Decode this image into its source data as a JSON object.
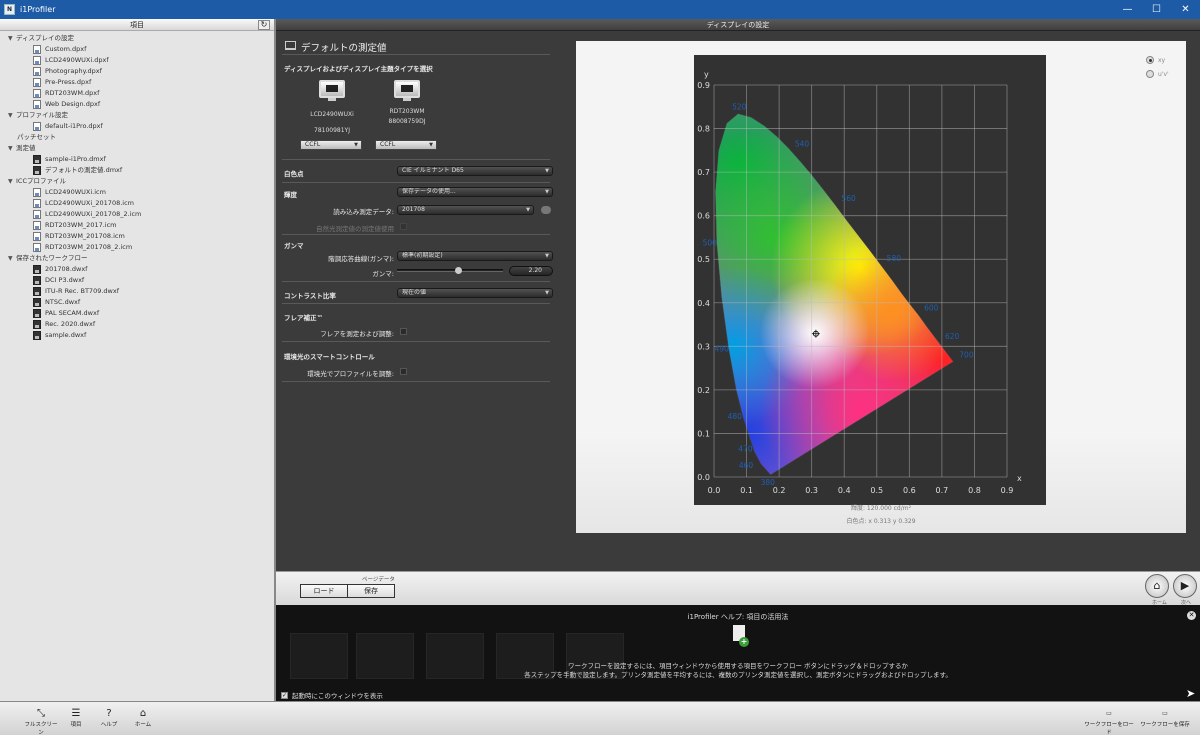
{
  "window": {
    "title": "i1Profiler",
    "app_icon": "N",
    "minimize": "—",
    "maximize": "☐",
    "close": "✕"
  },
  "left_panel": {
    "header": "項目",
    "refresh_icon": "↻",
    "tree": [
      {
        "type": "cat",
        "label": "ディスプレイの設定"
      },
      {
        "type": "leaf",
        "label": "Custom.dpxf",
        "icon": "file"
      },
      {
        "type": "leaf",
        "label": "LCD2490WUXi.dpxf",
        "icon": "file"
      },
      {
        "type": "leaf",
        "label": "Photography.dpxf",
        "icon": "file"
      },
      {
        "type": "leaf",
        "label": "Pre-Press.dpxf",
        "icon": "file"
      },
      {
        "type": "leaf",
        "label": "RDT203WM.dpxf",
        "icon": "file"
      },
      {
        "type": "leaf",
        "label": "Web Design.dpxf",
        "icon": "file"
      },
      {
        "type": "cat",
        "label": "プロファイル設定"
      },
      {
        "type": "leaf",
        "label": "default-i1Pro.dpxf",
        "icon": "file"
      },
      {
        "type": "plain",
        "label": "パッチセット"
      },
      {
        "type": "cat",
        "label": "測定値"
      },
      {
        "type": "leaf",
        "label": "sample-i1Pro.dmxf",
        "icon": "dark"
      },
      {
        "type": "leaf",
        "label": "デフォルトの測定値.dmxf",
        "icon": "dark"
      },
      {
        "type": "cat",
        "label": "ICCプロファイル"
      },
      {
        "type": "leaf",
        "label": "LCD2490WUXi.icm",
        "icon": "file"
      },
      {
        "type": "leaf",
        "label": "LCD2490WUXi_201708.icm",
        "icon": "file"
      },
      {
        "type": "leaf",
        "label": "LCD2490WUXi_201708_2.icm",
        "icon": "file"
      },
      {
        "type": "leaf",
        "label": "RDT203WM_2017.icm",
        "icon": "file"
      },
      {
        "type": "leaf",
        "label": "RDT203WM_201708.icm",
        "icon": "file"
      },
      {
        "type": "leaf",
        "label": "RDT203WM_201708_2.icm",
        "icon": "file"
      },
      {
        "type": "cat",
        "label": "保存されたワークフロー"
      },
      {
        "type": "leaf",
        "label": "201708.dwxf",
        "icon": "dark"
      },
      {
        "type": "leaf",
        "label": "DCI P3.dwxf",
        "icon": "dark"
      },
      {
        "type": "leaf",
        "label": "ITU-R Rec. BT709.dwxf",
        "icon": "dark"
      },
      {
        "type": "leaf",
        "label": "NTSC.dwxf",
        "icon": "dark"
      },
      {
        "type": "leaf",
        "label": "PAL SECAM.dwxf",
        "icon": "dark"
      },
      {
        "type": "leaf",
        "label": "Rec. 2020.dwxf",
        "icon": "dark"
      },
      {
        "type": "leaf",
        "label": "sample.dwxf",
        "icon": "dark"
      }
    ]
  },
  "section_header": "ディスプレイの設定",
  "settings": {
    "title": "デフォルトの測定値",
    "display_select_label": "ディスプレイおよびディスプレイ主題タイプを選択",
    "monitor1_name": "LCD2490WUXi",
    "monitor1_serial": "78100981YJ",
    "monitor2_name": "RDT203WM",
    "monitor2_serial": "88008759DJ",
    "monitor1_type": "CCFL",
    "monitor2_type": "CCFL",
    "white_point_label": "白色点",
    "white_point_value": "CIE イルミナント D65",
    "luminance_label": "輝度",
    "luminance_value": "保存データの使用...",
    "loaded_data_label": "読み込み測定データ:",
    "loaded_data_value": "201708",
    "ambient_label": "自然光測定値の測定値使用",
    "gamma_section_label": "ガンマ",
    "tone_curve_label": "階調応答曲線(ガンマ):",
    "tone_curve_value": "標準(初期設定)",
    "gamma_label": "ガンマ:",
    "gamma_value": "2.20",
    "contrast_label": "コントラスト比率",
    "contrast_value": "現在の値",
    "flare_label": "フレア補正™",
    "flare_check_label": "フレアを測定および調整:",
    "ambient_smart_label": "環境光のスマートコントロール",
    "ambient_smart_check_label": "環境光でプロファイルを調整:"
  },
  "chart_panel": {
    "radio_xy": "xy",
    "radio_uv": "u'v'",
    "footer_luminance": "輝度: 120.000 cd/m²",
    "footer_white_point": "白色点: x 0.313 y 0.329"
  },
  "chart_data": {
    "type": "scatter",
    "xlabel": "x",
    "ylabel": "y",
    "xlim": [
      0,
      0.9
    ],
    "ylim": [
      0,
      0.9
    ],
    "x_ticks": [
      "0.0",
      "0.1",
      "0.2",
      "0.3",
      "0.4",
      "0.5",
      "0.6",
      "0.7",
      "0.8",
      "0.9"
    ],
    "y_ticks": [
      "0.0",
      "0.1",
      "0.2",
      "0.3",
      "0.4",
      "0.5",
      "0.6",
      "0.7",
      "0.8",
      "0.9"
    ],
    "grid": true,
    "spectral_locus_labels": [
      {
        "label": "520",
        "x": 0.074,
        "y": 0.834
      },
      {
        "label": "540",
        "x": 0.23,
        "y": 0.754
      },
      {
        "label": "560",
        "x": 0.373,
        "y": 0.624
      },
      {
        "label": "580",
        "x": 0.512,
        "y": 0.487
      },
      {
        "label": "600",
        "x": 0.627,
        "y": 0.373
      },
      {
        "label": "620",
        "x": 0.691,
        "y": 0.308
      },
      {
        "label": "700",
        "x": 0.735,
        "y": 0.265
      },
      {
        "label": "500",
        "x": 0.008,
        "y": 0.538
      },
      {
        "label": "490",
        "x": 0.045,
        "y": 0.295
      },
      {
        "label": "480",
        "x": 0.091,
        "y": 0.133
      },
      {
        "label": "470",
        "x": 0.124,
        "y": 0.058
      },
      {
        "label": "460",
        "x": 0.144,
        "y": 0.03
      },
      {
        "label": "380",
        "x": 0.174,
        "y": 0.005
      }
    ],
    "white_point": {
      "x": 0.313,
      "y": 0.329
    }
  },
  "page_bar": {
    "label": "ページデータ",
    "load_label": "ロード",
    "save_label": "保存",
    "home_label": "ホーム",
    "next_label": "次へ",
    "home_icon": "⌂",
    "next_icon": "▶"
  },
  "help": {
    "title": "i1Profiler ヘルプ: 項目の活用法",
    "line1": "ワークフローを設定するには、項目ウィンドウから使用する項目をワークフロー ボタンにドラッグ＆ドロップするか",
    "line2": "各ステップを手動で設定します。プリンタ測定値を平均するには、複数のプリンタ測定値を選択し、測定ボタンにドラッグおよびドロップします。",
    "checkbox_label": "起動時にこのウィンドウを表示",
    "checkbox_mark": "✓",
    "close_icon": "✕",
    "plus_icon": "+"
  },
  "toolbar": {
    "fullscreen_label": "フルスクリーン",
    "items_label": "項目",
    "help_label": "ヘルプ",
    "home_label": "ホーム",
    "load_workflow_label": "ワークフローをロード",
    "save_workflow_label": "ワークフローを保存",
    "fullscreen_icon": "⤡",
    "items_icon": "☰",
    "help_icon": "?",
    "home_icon": "⌂"
  }
}
